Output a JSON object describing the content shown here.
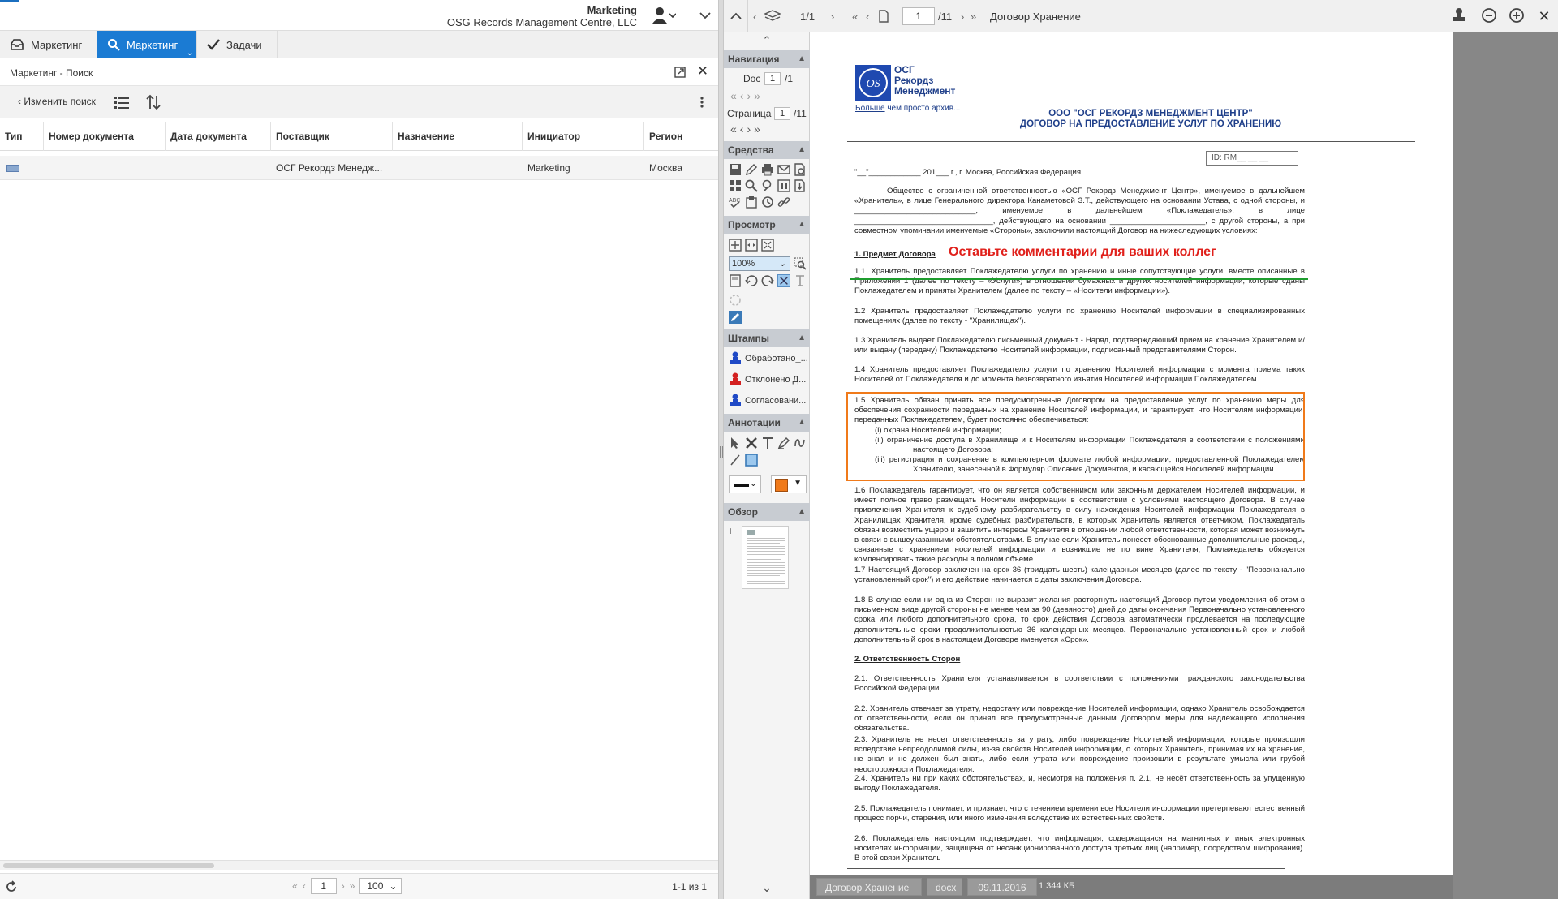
{
  "header": {
    "user_name": "Marketing",
    "org": "OSG Records Management Centre, LLC"
  },
  "tabs": [
    {
      "label": "Маркетинг"
    },
    {
      "label": "Маркетинг"
    },
    {
      "label": "Задачи"
    }
  ],
  "panel": {
    "title": "Маркетинг - Поиск",
    "change_search": "Изменить поиск"
  },
  "table": {
    "columns": [
      "Тип",
      "Номер документа",
      "Дата документа",
      "Поставщик",
      "Назначение",
      "Инициатор",
      "Регион"
    ],
    "rows": [
      {
        "type_icon": "document-type-icon",
        "number": "",
        "date": "",
        "supplier": "ОСГ Рекордз Менедж...",
        "purpose": "",
        "initiator": "Marketing",
        "region": "Москва"
      }
    ]
  },
  "footer": {
    "page": "1",
    "page_size": "100",
    "count": "1-1 из 1"
  },
  "viewer": {
    "doc_counter": "1/1",
    "page_input": "1",
    "page_total": "/11",
    "doc_title": "Договор Хранение",
    "sidebar": {
      "nav_title": "Навигация",
      "doc_label": "Doc",
      "doc_value": "1",
      "doc_total": "/1",
      "page_label": "Страница",
      "page_value": "1",
      "page_total": "/11",
      "tools_title": "Средства",
      "view_title": "Просмотр",
      "zoom": "100%",
      "stamps_title": "Штампы",
      "stamps": [
        {
          "label": "Обработано_...",
          "color": "#1f49c6"
        },
        {
          "label": "Отклонено Д...",
          "color": "#d32020"
        },
        {
          "label": "Согласовани...",
          "color": "#1f49c6"
        }
      ],
      "annot_title": "Аннотации",
      "overview_title": "Обзор"
    },
    "status": {
      "name": "Договор Хранение",
      "ext": "docx",
      "date": "09.11.2016",
      "size": "1 344 КБ"
    },
    "accent_orange": "#f07a1a",
    "annotation_red": "#e0201b",
    "annotation_green": "#1e9c2e"
  },
  "document": {
    "logo_line1": "ОСГ",
    "logo_line2": "Рекордз",
    "logo_line3": "Менеджмент",
    "logo_tag_a": "Больше",
    "logo_tag_b": " чем просто архив...",
    "company": "ООО \"ОСГ РЕКОРДЗ МЕНЕДЖМЕНТ ЦЕНТР\"",
    "contract_title": "ДОГОВОР НА ПРЕДОСТАВЛЕНИЕ УСЛУГ ПО ХРАНЕНИЮ",
    "id_box": "ID: RM__ __ __",
    "date_line": "\"__\"____________ 201___ г., г. Москва, Российская Федерация",
    "intro": "Общество с ограниченной ответственностью «ОСГ Рекордз Менеджмент Центр», именуемое в дальнейшем «Хранитель», в лице Генерального директора Канаметовой З.Т., действующего на основании Устава, с одной стороны, и ____________________________, именуемое в дальнейшем «Поклажедатель», в лице ________________________________, действующего на основании ______________________, с другой стороны, а при совместном упоминании именуемые «Стороны», заключили настоящий Договор на нижеследующих условиях:",
    "s1": "1.     Предмет Договора",
    "annotation": "Оставьте комментарии для ваших коллег",
    "p1_1": "1.1.  Хранитель предоставляет Поклажедателю услуги по хранению и иные сопутствующие услуги, вместе описанные в Приложении 1 (далее по тексту – «Услуги») в отношении бумажных и других носителей информации, которые сданы Поклажедателем и приняты Хранителем (далее по тексту – «Носители информации»).",
    "p1_2": "1.2   Хранитель предоставляет Поклажедателю услуги по хранению Носителей информации в специализированных помещениях (далее по тексту - \"Хранилищах\").",
    "p1_3": "1.3   Хранитель выдает Поклажедателю письменный документ - Наряд, подтверждающий прием на хранение Хранителем и/или выдачу (передачу) Поклажедателю Носителей информации, подписанный представителями Сторон.",
    "p1_4": "1.4   Хранитель предоставляет Поклажедателю услуги по хранению Носителей информации с момента приема таких Носителей от Поклажедателя и до момента безвозвратного изъятия Носителей информации Поклажедателем.",
    "p1_5": "1.5   Хранитель обязан принять все предусмотренные Договором на предоставление услуг по хранению меры для обеспечения сохранности переданных на хранение Носителей информации, и гарантирует, что Носителям информации, переданных Поклажедателем, будет постоянно обеспечиваться:",
    "p1_5_i": "(i)          охрана Носителей информации;",
    "p1_5_ii": "(ii)         ограничение доступа в Хранилище и к Носителям информации Поклажедателя в соответствии с положениями настоящего Договора;",
    "p1_5_iii": "(iii)        регистрация и сохранение в компьютерном формате любой информации, предоставленной Поклажедателем Хранителю, занесенной в Формуляр Описания Документов, и касающейся Носителей информации.",
    "p1_6": "1.6   Поклажедатель гарантирует, что он является собственником или законным держателем Носителей информации, и имеет полное право размещать Носители информации в соответствии с условиями настоящего Договора. В случае привлечения Хранителя к судебному разбирательству в силу нахождения Носителей информации Поклажедателя в Хранилищах Хранителя, кроме судебных разбирательств, в которых Хранитель является ответчиком, Поклажедатель обязан возместить ущерб и защитить интересы Хранителя в отношении любой ответственности, которая может возникнуть в связи с вышеуказанными обстоятельствами. В случае если Хранитель понесет обоснованные дополнительные расходы, связанные с хранением носителей информации и возникшие не по вине Хранителя, Поклажедатель обязуется компенсировать такие расходы в полном объеме.",
    "p1_7": "1.7   Настоящий Договор заключен на срок 36 (тридцать шесть) календарных месяцев (далее по тексту - \"Первоначально установленный срок\") и его действие начинается с даты заключения Договора.",
    "p1_8": "1.8   В случае если ни одна из Сторон не выразит желания расторгнуть настоящий Договор путем уведомления об этом в письменном виде другой стороны не менее чем за 90 (девяносто) дней до даты окончания Первоначально установленного срока или любого дополнительного срока, то срок действия Договора автоматически продлевается на последующие дополнительные сроки продолжительностью 36 календарных месяцев. Первоначально установленный срок и любой дополнительный срок в настоящем Договоре именуется «Срок».",
    "s2": "2.     Ответственность Сторон",
    "p2_1": "2.1. Ответственность  Хранителя устанавливается в соответствии с положениями гражданского законодательства Российской Федерации.",
    "p2_2": "2.2. Хранитель отвечает за утрату, недостачу или повреждение Носителей информации, однако Хранитель освобождается от ответственности, если он принял все предусмотренные данным Договором меры для надлежащего исполнения обязательства.",
    "p2_3": "2.3. Хранитель не несет ответственность за утрату, либо повреждение Носителей информации, которые произошли вследствие непреодолимой силы, из-за свойств Носителей информации, о которых Хранитель, принимая их на хранение, не знал и не должен был знать, либо если утрата или повреждение произошли в результате умысла или грубой неосторожности Поклажедателя.",
    "p2_4": "2.4. Хранитель ни при каких обстоятельствах, и, несмотря на положения п. 2.1, не несёт ответственность за упущенную выгоду Поклажедателя.",
    "p2_5": "2.5. Поклажедатель понимает, и признает, что с течением времени все Носители информации  претерпевают естественный процесс порчи, старения, или иного изменения вследствие их естественных свойств.",
    "p2_6": "2.6. Поклажедатель настоящим подтверждает, что информация, содержащаяся на магнитных и иных электронных носителях информации, защищена от несанкционированного доступа третьих лиц (например, посредством шифрования). В этой связи Хранитель"
  }
}
